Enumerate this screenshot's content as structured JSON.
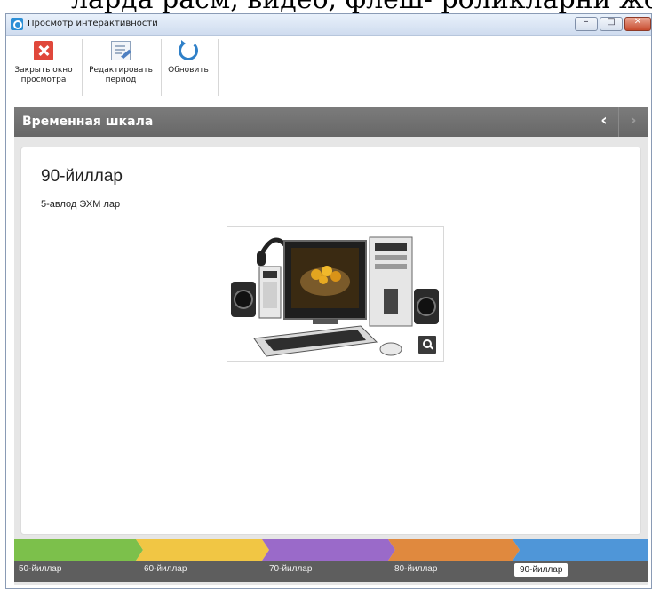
{
  "caption": {
    "text": "ларда расм, видео, флеш- роликларни жойла"
  },
  "window": {
    "title": "Просмотр интерактивности",
    "buttons": {
      "minimize": "–",
      "maximize": "□",
      "close": "✕"
    }
  },
  "toolbar": {
    "close_preview": {
      "label_line1": "Закрыть окно",
      "label_line2": "просмотра",
      "icon": "close-icon"
    },
    "edit_period": {
      "label_line1": "Редактировать",
      "label_line2": "период",
      "icon": "edit-icon"
    },
    "refresh": {
      "label": "Обновить",
      "icon": "refresh-icon"
    }
  },
  "panel": {
    "title": "Временная шкала",
    "nav_prev": "‹",
    "nav_next": "›"
  },
  "content": {
    "title": "90-йиллар",
    "subtitle": "5-авлод ЭХМ лар",
    "image": {
      "description": "computer-illustration",
      "zoom_icon": "magnifier-icon"
    }
  },
  "timeline": {
    "segments": [
      {
        "label": "50-йиллар",
        "color": "#7cc04b",
        "active": false
      },
      {
        "label": "60-йиллар",
        "color": "#f1c644",
        "active": false
      },
      {
        "label": "70-йиллар",
        "color": "#9a6ac9",
        "active": false
      },
      {
        "label": "80-йиллар",
        "color": "#e0893e",
        "active": false
      },
      {
        "label": "90-йиллар",
        "color": "#4f96d8",
        "active": true
      }
    ]
  }
}
